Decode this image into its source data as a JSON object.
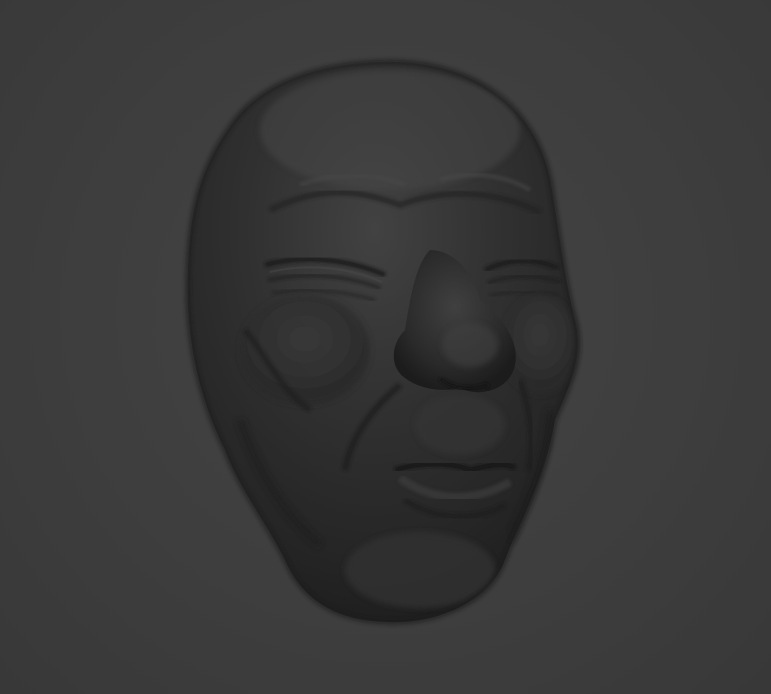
{
  "scene": {
    "background_color": "#3d3d3d",
    "model_base_color": "#2b2b2b",
    "model_highlight_color": "#4a4a4a",
    "model_shadow_color": "#1e1e1e",
    "subject": "sculpted-head-mesh"
  }
}
